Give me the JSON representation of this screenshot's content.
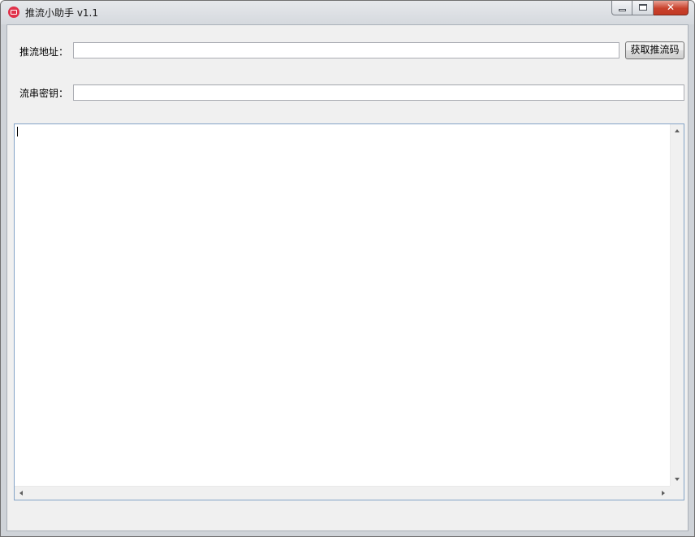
{
  "window": {
    "title": "推流小助手 v1.1",
    "colors": {
      "close_button": "#c8412c",
      "memo_border": "#83a3c7",
      "client_bg": "#f0f0f0"
    }
  },
  "form": {
    "push_address_label": "推流地址：",
    "push_address_value": "",
    "get_code_button": "获取推流码",
    "stream_key_label": "流串密钥：",
    "stream_key_value": ""
  },
  "output": {
    "text": ""
  }
}
